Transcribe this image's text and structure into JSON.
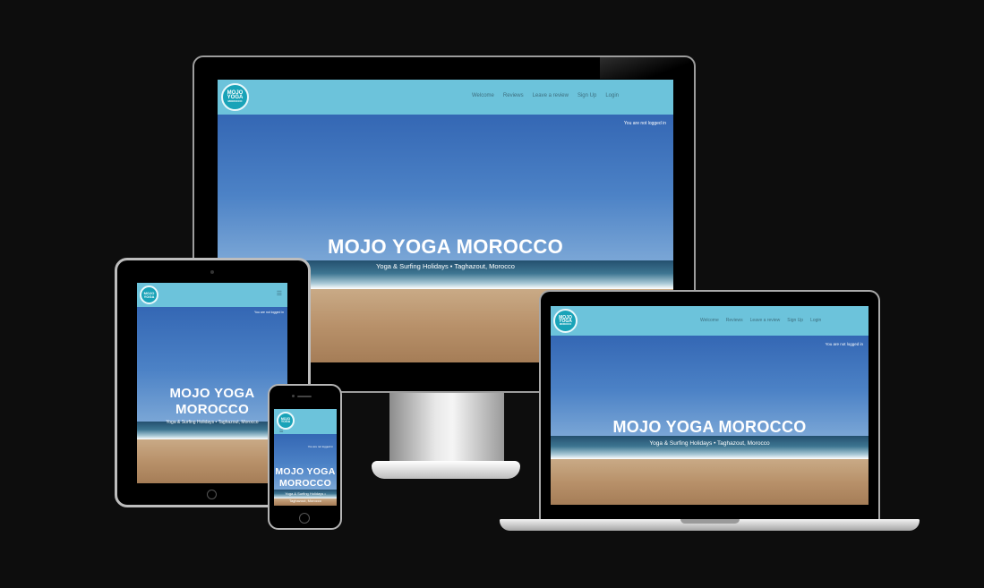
{
  "site": {
    "logo_text": [
      "MOJO",
      "YOGA",
      "MOROCCO"
    ],
    "nav_links": [
      "Welcome",
      "Reviews",
      "Leave a review",
      "Sign Up",
      "Login"
    ],
    "login_status": "You are not logged in",
    "hero_title": "MOJO YOGA MOROCCO",
    "hero_title_lines": [
      "MOJO YOGA",
      "MOROCCO"
    ],
    "hero_subtitle": "Yoga & Surfing Holidays • Taghazout, Morocco",
    "phone_subtitle_lines": [
      "Yoga & Surfing Holidays •",
      "Taghazout, Morocco"
    ],
    "menu_icon": "hamburger-icon"
  },
  "colors": {
    "navbar": "#6cc3db",
    "logo_badge": "#19a3b8",
    "background": "#0d0d0d"
  }
}
